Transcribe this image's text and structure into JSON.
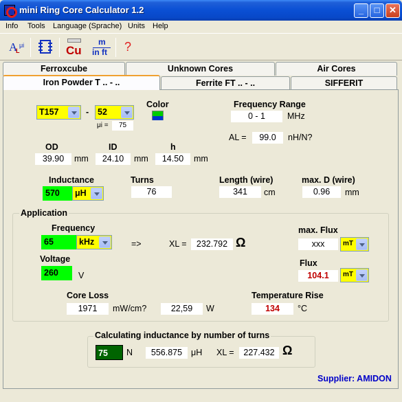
{
  "window": {
    "title": "mini Ring Core Calculator 1.2",
    "minimize": "_",
    "maximize": "□",
    "close": "✕"
  },
  "menu": [
    "Info",
    "Tools",
    "Language (Sprache)",
    "Units",
    "Help"
  ],
  "toolbar": {
    "al_icon": "A",
    "al_sub_l": "L",
    "al_sub_mu": "μi",
    "cu_label": "Cu",
    "m_label": "m",
    "inft_label": "in ft",
    "help_label": "?"
  },
  "tabs_top": [
    "Ferroxcube",
    "Unknown Cores",
    "Air Cores"
  ],
  "tabs_bottom": [
    "Iron Powder T .. - ..",
    "Ferrite FT .. - ..",
    "SIFFERIT"
  ],
  "core": {
    "size": "T157",
    "dash": "-",
    "material": "52",
    "mu_label": "μi =",
    "mu_value": "75",
    "color_label": "Color",
    "color_top": "#00cc00",
    "color_bottom": "#0033cc"
  },
  "freq_range": {
    "label": "Frequency Range",
    "value": "0 - 1",
    "unit": "MHz"
  },
  "al": {
    "label": "AL =",
    "value": "99.0",
    "unit": "nH/N?"
  },
  "dims": {
    "od_label": "OD",
    "od_value": "39.90",
    "od_unit": "mm",
    "id_label": "ID",
    "id_value": "24.10",
    "id_unit": "mm",
    "h_label": "h",
    "h_value": "14.50",
    "h_unit": "mm"
  },
  "inductance": {
    "label": "Inductance",
    "value": "570",
    "unit": "μH"
  },
  "turns": {
    "label": "Turns",
    "value": "76"
  },
  "wire_length": {
    "label": "Length (wire)",
    "value": "341",
    "unit": "cm"
  },
  "wire_d": {
    "label": "max. D (wire)",
    "value": "0.96",
    "unit": "mm"
  },
  "application": {
    "title": "Application",
    "freq_label": "Frequency",
    "freq_value": "65",
    "freq_unit": "kHz",
    "arrow": "=>",
    "xl_label": "XL =",
    "xl_value": "232.792",
    "ohm": "Ω",
    "maxflux_label": "max. Flux",
    "maxflux_value": "xxx",
    "maxflux_unit": "mT",
    "voltage_label": "Voltage",
    "voltage_value": "260",
    "voltage_unit": "V",
    "flux_label": "Flux",
    "flux_value": "104.1",
    "flux_unit": "mT",
    "coreloss_label": "Core Loss",
    "coreloss_value": "1971",
    "coreloss_unit": "mW/cm?",
    "loss_w_value": "22,59",
    "loss_w_unit": "W",
    "temp_label": "Temperature Rise",
    "temp_value": "134",
    "temp_unit": "°C"
  },
  "calc": {
    "title": "Calculating inductance by number of turns",
    "turns_value": "75",
    "turns_unit": "N",
    "ind_value": "556.875",
    "ind_unit": "μH",
    "xl_label": "XL =",
    "xl_value": "227.432",
    "ohm": "Ω"
  },
  "supplier": "Supplier: AMIDON"
}
